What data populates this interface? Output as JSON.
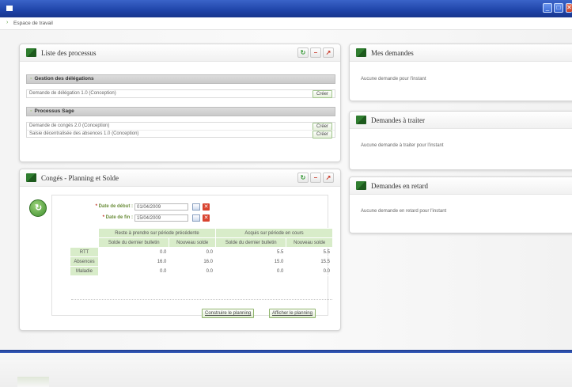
{
  "window": {
    "minimize": "_",
    "maximize": "□",
    "close": "✕"
  },
  "breadcrumb": {
    "label": "Espace de travail"
  },
  "processus": {
    "title": "Liste des processus",
    "groups": [
      {
        "name": "Gestion des délégations",
        "items": [
          {
            "label": "Demande de délégation 1.0 (Conception)",
            "action": "Créer"
          }
        ]
      },
      {
        "name": "Processus Sage",
        "items": [
          {
            "label": "Demande de congés 2.0 (Conception)",
            "action": "Créer"
          },
          {
            "label": "Saisie décentralisée des absences 1.0 (Conception)",
            "action": "Créer"
          }
        ]
      }
    ]
  },
  "conges": {
    "title": "Congés - Planning et Solde",
    "date_debut": {
      "label": "Date de début :",
      "value": "01/04/2009"
    },
    "date_fin": {
      "label": "Date de fin :",
      "value": "15/04/2009"
    },
    "table": {
      "group_headers": [
        "Reste à prendre sur période précédente",
        "Acquis sur période en cours"
      ],
      "sub_headers": [
        "Solde du dernier bulletin",
        "Nouveau solde",
        "Solde du dernier bulletin",
        "Nouveau solde"
      ],
      "rows": [
        {
          "name": "RTT",
          "values": [
            "0.0",
            "0.0",
            "5.5",
            "5.5"
          ]
        },
        {
          "name": "Absences",
          "values": [
            "16.0",
            "16.0",
            "15.0",
            "15.5"
          ]
        },
        {
          "name": "Maladie",
          "values": [
            "0.0",
            "0.0",
            "0.0",
            "0.0"
          ]
        }
      ]
    },
    "buttons": {
      "construire": "Construire le planning",
      "afficher": "Afficher le planning"
    }
  },
  "mes_demandes": {
    "title": "Mes demandes",
    "message": "Aucune demande pour l'instant"
  },
  "demandes_traiter": {
    "title": "Demandes à traiter",
    "message": "Aucune demande à traiter pour l'instant"
  },
  "demandes_retard": {
    "title": "Demandes en retard",
    "message": "Aucune demande en retard pour l'instant"
  }
}
